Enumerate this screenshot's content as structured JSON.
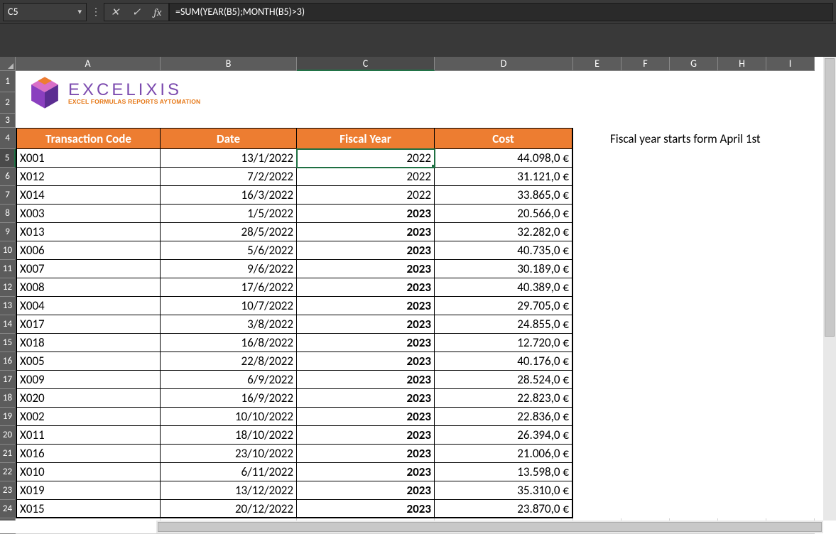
{
  "nameBox": "C5",
  "formula": "=SUM(YEAR(B5);MONTH(B5)>3)",
  "columns": [
    "A",
    "B",
    "C",
    "D",
    "E",
    "F",
    "G",
    "H",
    "I"
  ],
  "colWidths": {
    "A": 204,
    "B": 192,
    "C": 194,
    "D": 195,
    "E": 68,
    "F": 68,
    "G": 68,
    "H": 68,
    "I": 68
  },
  "logo": {
    "brand": "EXCELIXIS",
    "tagline": "EXCEL FORMULAS REPORTS AYTOMATION"
  },
  "tableHeaders": {
    "A": "Transaction Code",
    "B": "Date",
    "C": "Fiscal Year",
    "D": "Cost"
  },
  "rows": [
    {
      "code": "X001",
      "date": "13/1/2022",
      "fy": "2022",
      "bold": false,
      "cost": "44.098,0 €"
    },
    {
      "code": "X012",
      "date": "7/2/2022",
      "fy": "2022",
      "bold": false,
      "cost": "31.121,0 €"
    },
    {
      "code": "X014",
      "date": "16/3/2022",
      "fy": "2022",
      "bold": false,
      "cost": "33.865,0 €"
    },
    {
      "code": "X003",
      "date": "1/5/2022",
      "fy": "2023",
      "bold": true,
      "cost": "20.566,0 €"
    },
    {
      "code": "X013",
      "date": "28/5/2022",
      "fy": "2023",
      "bold": true,
      "cost": "32.282,0 €"
    },
    {
      "code": "X006",
      "date": "5/6/2022",
      "fy": "2023",
      "bold": true,
      "cost": "40.735,0 €"
    },
    {
      "code": "X007",
      "date": "9/6/2022",
      "fy": "2023",
      "bold": true,
      "cost": "30.189,0 €"
    },
    {
      "code": "X008",
      "date": "17/6/2022",
      "fy": "2023",
      "bold": true,
      "cost": "40.389,0 €"
    },
    {
      "code": "X004",
      "date": "10/7/2022",
      "fy": "2023",
      "bold": true,
      "cost": "29.705,0 €"
    },
    {
      "code": "X017",
      "date": "3/8/2022",
      "fy": "2023",
      "bold": true,
      "cost": "24.855,0 €"
    },
    {
      "code": "X018",
      "date": "16/8/2022",
      "fy": "2023",
      "bold": true,
      "cost": "12.720,0 €"
    },
    {
      "code": "X005",
      "date": "22/8/2022",
      "fy": "2023",
      "bold": true,
      "cost": "40.176,0 €"
    },
    {
      "code": "X009",
      "date": "6/9/2022",
      "fy": "2023",
      "bold": true,
      "cost": "28.524,0 €"
    },
    {
      "code": "X020",
      "date": "16/9/2022",
      "fy": "2023",
      "bold": true,
      "cost": "22.823,0 €"
    },
    {
      "code": "X002",
      "date": "10/10/2022",
      "fy": "2023",
      "bold": true,
      "cost": "22.836,0 €"
    },
    {
      "code": "X011",
      "date": "18/10/2022",
      "fy": "2023",
      "bold": true,
      "cost": "26.394,0 €"
    },
    {
      "code": "X016",
      "date": "23/10/2022",
      "fy": "2023",
      "bold": true,
      "cost": "21.006,0 €"
    },
    {
      "code": "X010",
      "date": "6/11/2022",
      "fy": "2023",
      "bold": true,
      "cost": "13.598,0 €"
    },
    {
      "code": "X019",
      "date": "13/12/2022",
      "fy": "2023",
      "bold": true,
      "cost": "35.310,0 €"
    },
    {
      "code": "X015",
      "date": "20/12/2022",
      "fy": "2023",
      "bold": true,
      "cost": "23.870,0 €"
    }
  ],
  "note": "Fiscal year starts form April 1st",
  "selectedCell": "C5",
  "selectedRowHeader": "5",
  "selectedColHeader": "C"
}
